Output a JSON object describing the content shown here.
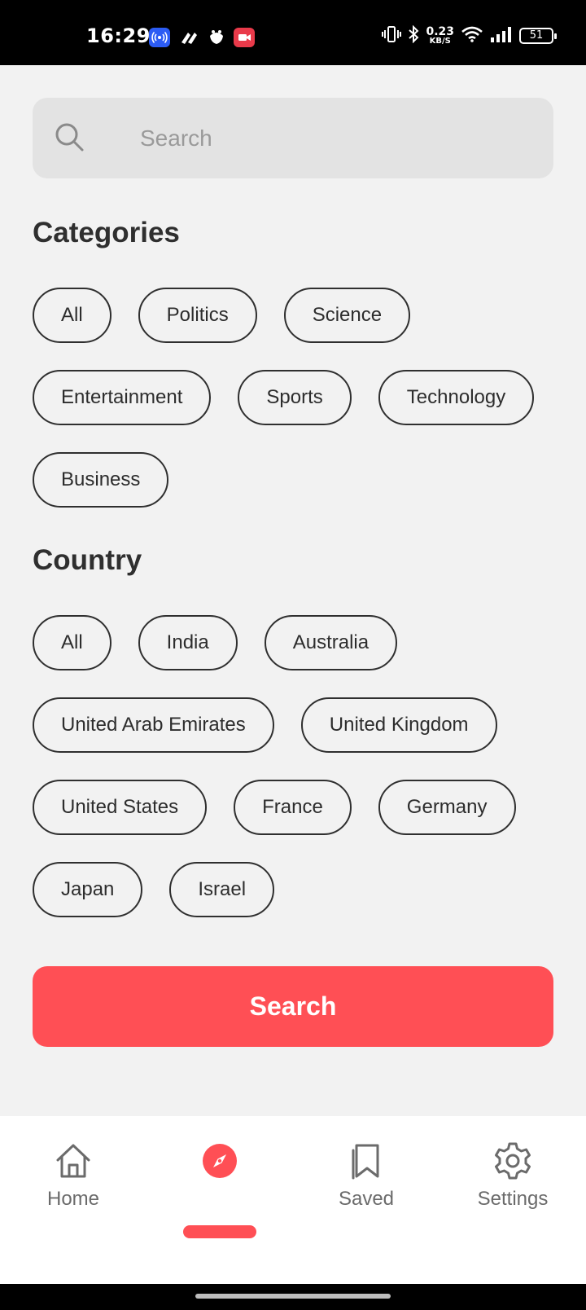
{
  "status_bar": {
    "time": "16:29",
    "net_speed_value": "0.23",
    "net_speed_unit": "KB/S",
    "battery": "51"
  },
  "search": {
    "placeholder": "Search"
  },
  "categories": {
    "title": "Categories",
    "items": [
      "All",
      "Politics",
      "Science",
      "Entertainment",
      "Sports",
      "Technology",
      "Business"
    ]
  },
  "country": {
    "title": "Country",
    "items": [
      "All",
      "India",
      "Australia",
      "United Arab Emirates",
      "United Kingdom",
      "United States",
      "France",
      "Germany",
      "Japan",
      "Israel"
    ]
  },
  "search_button": {
    "label": "Search"
  },
  "bottom_nav": {
    "active": "explore",
    "items": [
      {
        "id": "home",
        "label": "Home",
        "icon": "home-icon"
      },
      {
        "id": "explore",
        "label": "",
        "icon": "compass-icon"
      },
      {
        "id": "saved",
        "label": "Saved",
        "icon": "bookmark-icon"
      },
      {
        "id": "settings",
        "label": "Settings",
        "icon": "gear-icon"
      }
    ]
  },
  "colors": {
    "accent": "#ff4f55",
    "background": "#f2f2f2",
    "search_field": "#e3e3e3",
    "chip_border": "#2f2f2f"
  }
}
